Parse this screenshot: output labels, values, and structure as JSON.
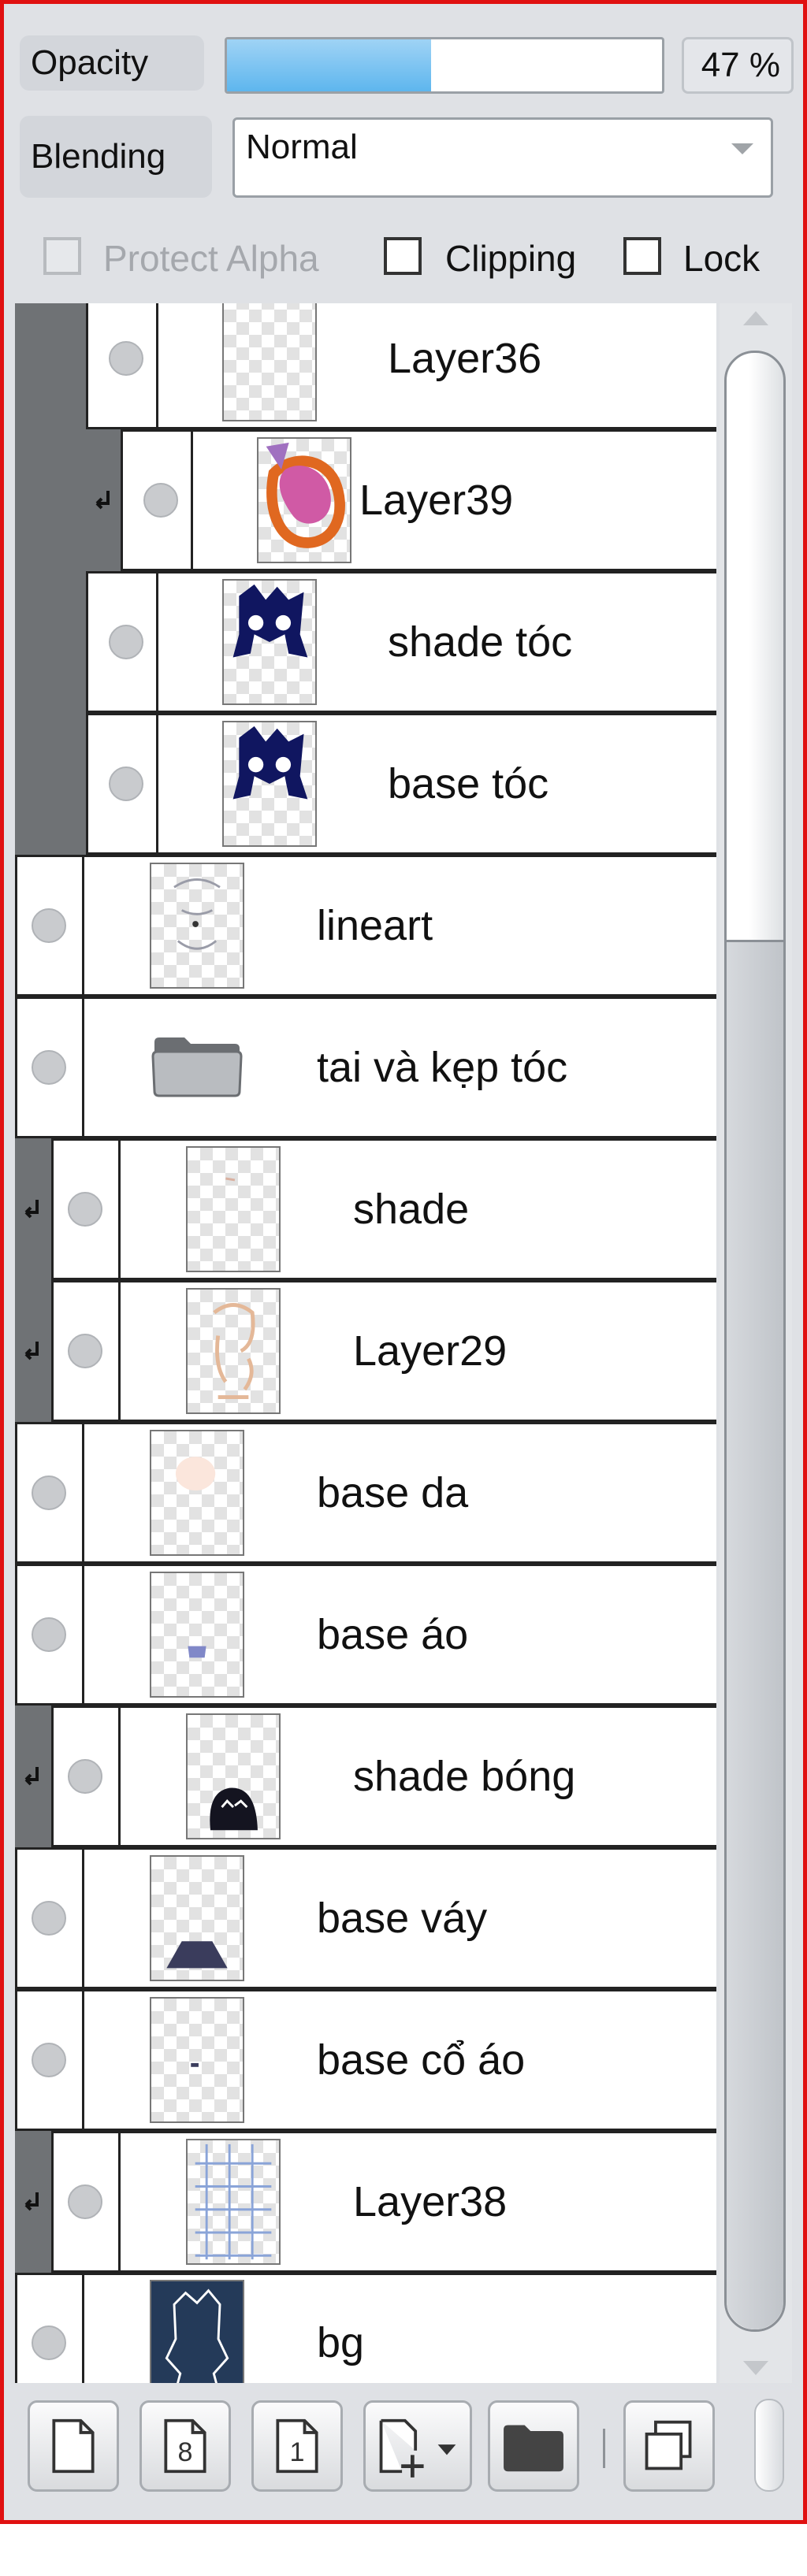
{
  "header": {
    "opacity_label": "Opacity",
    "opacity_value": "47 %",
    "opacity_fraction": 0.47,
    "blending_label": "Blending",
    "blending_value": "Normal"
  },
  "options": {
    "protect_alpha": "Protect Alpha",
    "clipping": "Clipping",
    "lock": "Lock"
  },
  "layers": [
    {
      "name": "Layer36",
      "thumb": "empty"
    },
    {
      "name": "Layer39",
      "thumb": "orange-pink-shape",
      "clipped": true
    },
    {
      "name": "shade tóc",
      "thumb": "dark-hair"
    },
    {
      "name": "base tóc",
      "thumb": "dark-hair"
    },
    {
      "name": "lineart",
      "thumb": "faint-lines"
    },
    {
      "name": "tai và kẹp tóc",
      "thumb": "folder-icon"
    },
    {
      "name": "shade",
      "thumb": "empty",
      "clipped": true
    },
    {
      "name": "Layer29",
      "thumb": "skin-sketch",
      "clipped": true
    },
    {
      "name": "base da",
      "thumb": "skin-blob"
    },
    {
      "name": "base áo",
      "thumb": "small-purple-shape"
    },
    {
      "name": "shade bóng",
      "thumb": "dark-blob",
      "clipped": true
    },
    {
      "name": "base váy",
      "thumb": "skirt-shape"
    },
    {
      "name": "base cổ áo",
      "thumb": "tiny-dot"
    },
    {
      "name": "Layer38",
      "thumb": "blue-grid",
      "clipped": true
    },
    {
      "name": "bg",
      "thumb": "navy-silhouette"
    }
  ],
  "toolbar": {
    "buttons": [
      "new-layer-icon",
      "new-8bit-layer-icon",
      "new-1bit-layer-icon",
      "add-layer-dropdown-icon",
      "new-folder-icon",
      "duplicate-layer-icon"
    ],
    "button_8_label": "8",
    "button_1_label": "1"
  },
  "colors": {
    "border_accent": "#e01010",
    "opacity_fill": "#5eb6ee",
    "group_gutter": "#6f7275",
    "bg_thumb": "#243a59"
  }
}
